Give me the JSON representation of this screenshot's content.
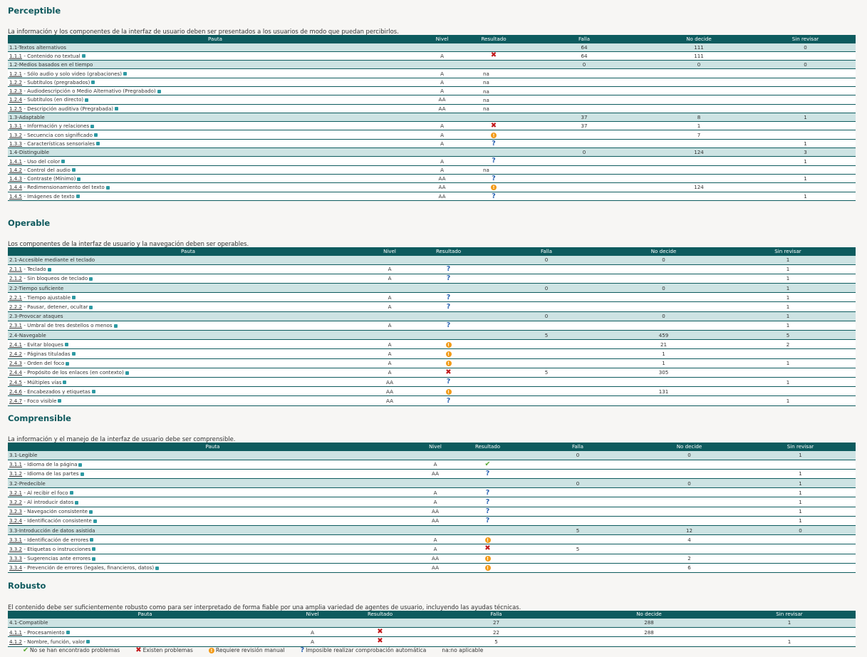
{
  "headers": [
    "Pauta",
    "Nivel",
    "Resultado",
    "Falla",
    "No decide",
    "Sin revisar"
  ],
  "sections": [
    {
      "title": "Perceptible",
      "description": "La información y los componentes de la interfaz de usuario deben ser presentados a los usuarios de modo que puedan percibirlos.",
      "groups": [
        {
          "label": "1.1-Textos alternativos",
          "falla": "64",
          "no_decide": "111",
          "sin_revisar": "0",
          "items": [
            {
              "code": "1.1.1",
              "name": " - Contenido no textual",
              "level": "A",
              "result": "fail",
              "falla": "64",
              "no_decide": "111",
              "sin_revisar": ""
            }
          ]
        },
        {
          "label": "1.2-Medios basados en el tiempo",
          "falla": "0",
          "no_decide": "0",
          "sin_revisar": "0",
          "items": [
            {
              "code": "1.2.1",
              "name": " - Sólo audio y solo video (grabaciones)",
              "level": "A",
              "result": "na",
              "falla": "",
              "no_decide": "",
              "sin_revisar": ""
            },
            {
              "code": "1.2.2",
              "name": " - Subtítulos (pregrabados)",
              "level": "A",
              "result": "na",
              "falla": "",
              "no_decide": "",
              "sin_revisar": ""
            },
            {
              "code": "1.2.3",
              "name": " - Audiodescripción o Medio Alternativo (Pregrabado)",
              "level": "A",
              "result": "na",
              "falla": "",
              "no_decide": "",
              "sin_revisar": ""
            },
            {
              "code": "1.2.4",
              "name": " - Subtítulos (en directo)",
              "level": "AA",
              "result": "na",
              "falla": "",
              "no_decide": "",
              "sin_revisar": ""
            },
            {
              "code": "1.2.5",
              "name": " - Descripción auditiva (Pregrabada)",
              "level": "AA",
              "result": "na",
              "falla": "",
              "no_decide": "",
              "sin_revisar": ""
            }
          ]
        },
        {
          "label": "1.3-Adaptable",
          "falla": "37",
          "no_decide": "8",
          "sin_revisar": "1",
          "items": [
            {
              "code": "1.3.1",
              "name": " - Información y relaciones",
              "level": "A",
              "result": "fail",
              "falla": "37",
              "no_decide": "1",
              "sin_revisar": ""
            },
            {
              "code": "1.3.2",
              "name": " - Secuencia con significado",
              "level": "A",
              "result": "warn",
              "falla": "",
              "no_decide": "7",
              "sin_revisar": ""
            },
            {
              "code": "1.3.3",
              "name": " - Características sensoriales",
              "level": "A",
              "result": "question",
              "falla": "",
              "no_decide": "",
              "sin_revisar": "1"
            }
          ]
        },
        {
          "label": "1.4-Distinguible",
          "falla": "0",
          "no_decide": "124",
          "sin_revisar": "3",
          "items": [
            {
              "code": "1.4.1",
              "name": " - Uso del color",
              "level": "A",
              "result": "question",
              "falla": "",
              "no_decide": "",
              "sin_revisar": "1"
            },
            {
              "code": "1.4.2",
              "name": " - Control del audio",
              "level": "A",
              "result": "na",
              "falla": "",
              "no_decide": "",
              "sin_revisar": ""
            },
            {
              "code": "1.4.3",
              "name": " - Contraste (Mínimo)",
              "level": "AA",
              "result": "question",
              "falla": "",
              "no_decide": "",
              "sin_revisar": "1"
            },
            {
              "code": "1.4.4",
              "name": " - Redimensionamiento del texto",
              "level": "AA",
              "result": "warn",
              "falla": "",
              "no_decide": "124",
              "sin_revisar": ""
            },
            {
              "code": "1.4.5",
              "name": " - Imágenes de texto",
              "level": "AA",
              "result": "question",
              "falla": "",
              "no_decide": "",
              "sin_revisar": "1"
            }
          ]
        }
      ]
    },
    {
      "title": "Operable",
      "description": "Los componentes de la interfaz de usuario y la navegación deben ser operables.",
      "groups": [
        {
          "label": "2.1-Accesible mediante el teclado",
          "falla": "0",
          "no_decide": "0",
          "sin_revisar": "1",
          "items": [
            {
              "code": "2.1.1",
              "name": " - Teclado",
              "level": "A",
              "result": "question",
              "falla": "",
              "no_decide": "",
              "sin_revisar": "1"
            },
            {
              "code": "2.1.2",
              "name": " - Sin bloqueos de teclado",
              "level": "A",
              "result": "question",
              "falla": "",
              "no_decide": "",
              "sin_revisar": "1"
            }
          ]
        },
        {
          "label": "2.2-Tiempo suficiente",
          "falla": "0",
          "no_decide": "0",
          "sin_revisar": "1",
          "items": [
            {
              "code": "2.2.1",
              "name": " - Tiempo ajustable",
              "level": "A",
              "result": "question",
              "falla": "",
              "no_decide": "",
              "sin_revisar": "1"
            },
            {
              "code": "2.2.2",
              "name": " - Pausar, detener, ocultar",
              "level": "A",
              "result": "question",
              "falla": "",
              "no_decide": "",
              "sin_revisar": "1"
            }
          ]
        },
        {
          "label": "2.3-Provocar ataques",
          "falla": "0",
          "no_decide": "0",
          "sin_revisar": "1",
          "items": [
            {
              "code": "2.3.1",
              "name": " - Umbral de tres destellos o menos",
              "level": "A",
              "result": "question",
              "falla": "",
              "no_decide": "",
              "sin_revisar": "1"
            }
          ]
        },
        {
          "label": "2.4-Navegable",
          "falla": "5",
          "no_decide": "459",
          "sin_revisar": "5",
          "items": [
            {
              "code": "2.4.1",
              "name": " - Evitar bloques",
              "level": "A",
              "result": "warn",
              "falla": "",
              "no_decide": "21",
              "sin_revisar": "2"
            },
            {
              "code": "2.4.2",
              "name": " - Páginas tituladas",
              "level": "A",
              "result": "warn",
              "falla": "",
              "no_decide": "1",
              "sin_revisar": ""
            },
            {
              "code": "2.4.3",
              "name": " - Orden del foco",
              "level": "A",
              "result": "warn",
              "falla": "",
              "no_decide": "1",
              "sin_revisar": "1"
            },
            {
              "code": "2.4.4",
              "name": " - Propósito de los enlaces (en contexto)",
              "level": "A",
              "result": "fail",
              "falla": "5",
              "no_decide": "305",
              "sin_revisar": ""
            },
            {
              "code": "2.4.5",
              "name": " - Múltiples vías",
              "level": "AA",
              "result": "question",
              "falla": "",
              "no_decide": "",
              "sin_revisar": "1"
            },
            {
              "code": "2.4.6",
              "name": " - Encabezados y etiquetas",
              "level": "AA",
              "result": "warn",
              "falla": "",
              "no_decide": "131",
              "sin_revisar": ""
            },
            {
              "code": "2.4.7",
              "name": " - Foco visible",
              "level": "AA",
              "result": "question",
              "falla": "",
              "no_decide": "",
              "sin_revisar": "1"
            }
          ]
        }
      ]
    },
    {
      "title": "Comprensible",
      "description": "La información y el manejo de la interfaz de usuario debe ser comprensible.",
      "groups": [
        {
          "label": "3.1-Legible",
          "falla": "0",
          "no_decide": "0",
          "sin_revisar": "1",
          "items": [
            {
              "code": "3.1.1",
              "name": " - Idioma de la página",
              "level": "A",
              "result": "ok",
              "falla": "",
              "no_decide": "",
              "sin_revisar": ""
            },
            {
              "code": "3.1.2",
              "name": " - Idioma de las partes",
              "level": "AA",
              "result": "question",
              "falla": "",
              "no_decide": "",
              "sin_revisar": "1"
            }
          ]
        },
        {
          "label": "3.2-Predecible",
          "falla": "0",
          "no_decide": "0",
          "sin_revisar": "1",
          "items": [
            {
              "code": "3.2.1",
              "name": " - Al recibir el foco",
              "level": "A",
              "result": "question",
              "falla": "",
              "no_decide": "",
              "sin_revisar": "1"
            },
            {
              "code": "3.2.2",
              "name": " - Al introducir datos",
              "level": "A",
              "result": "question",
              "falla": "",
              "no_decide": "",
              "sin_revisar": "1"
            },
            {
              "code": "3.2.3",
              "name": " - Navegación consistente",
              "level": "AA",
              "result": "question",
              "falla": "",
              "no_decide": "",
              "sin_revisar": "1"
            },
            {
              "code": "3.2.4",
              "name": " - Identificación consistente",
              "level": "AA",
              "result": "question",
              "falla": "",
              "no_decide": "",
              "sin_revisar": "1"
            }
          ]
        },
        {
          "label": "3.3-Introducción de datos asistida",
          "falla": "5",
          "no_decide": "12",
          "sin_revisar": "0",
          "items": [
            {
              "code": "3.3.1",
              "name": " - Identificación de errores",
              "level": "A",
              "result": "warn",
              "falla": "",
              "no_decide": "4",
              "sin_revisar": ""
            },
            {
              "code": "3.3.2",
              "name": " - Etiquetas o instrucciones",
              "level": "A",
              "result": "fail",
              "falla": "5",
              "no_decide": "",
              "sin_revisar": ""
            },
            {
              "code": "3.3.3",
              "name": " - Sugerencias ante errores",
              "level": "AA",
              "result": "warn",
              "falla": "",
              "no_decide": "2",
              "sin_revisar": ""
            },
            {
              "code": "3.3.4",
              "name": " - Prevención de errores (legales, financieros, datos)",
              "level": "AA",
              "result": "warn",
              "falla": "",
              "no_decide": "6",
              "sin_revisar": ""
            }
          ]
        }
      ]
    },
    {
      "title": "Robusto",
      "description": "El contenido debe ser suficientemente robusto como para ser interpretado de forma fiable por una amplia variedad de agentes de usuario, incluyendo las ayudas técnicas.",
      "groups": [
        {
          "label": "4.1-Compatible",
          "falla": "27",
          "no_decide": "288",
          "sin_revisar": "1",
          "items": [
            {
              "code": "4.1.1",
              "name": " - Procesamiento",
              "level": "A",
              "result": "fail",
              "falla": "22",
              "no_decide": "288",
              "sin_revisar": ""
            },
            {
              "code": "4.1.2",
              "name": " - Nombre, función, valor",
              "level": "A",
              "result": "fail",
              "falla": "5",
              "no_decide": "",
              "sin_revisar": "1"
            }
          ]
        }
      ]
    }
  ],
  "legend": [
    {
      "icon": "ok",
      "label": "No se han encontrado problemas"
    },
    {
      "icon": "fail",
      "label": "Existen problemas"
    },
    {
      "icon": "warn",
      "label": "Requiere revisión manual"
    },
    {
      "icon": "question",
      "label": "Imposible realizar comprobación automática"
    },
    {
      "icon": "na-text",
      "label": "na:no aplicable"
    }
  ],
  "icons": {
    "ok": {
      "glyph": "✔",
      "name": "check-icon",
      "color": "#55a833"
    },
    "fail": {
      "glyph": "✖",
      "name": "cross-icon",
      "color": "#c2171a"
    },
    "warn": {
      "glyph": "!",
      "name": "warning-icon",
      "color": "#f39a17"
    },
    "question": {
      "glyph": "?",
      "name": "question-icon",
      "color": "#2a63b2"
    },
    "na": {
      "glyph": "na",
      "name": "na-text"
    }
  },
  "colors": {
    "header_bg": "#0d5b5e",
    "category_bg": "#cde3e3",
    "title": "#0f5a5e"
  }
}
